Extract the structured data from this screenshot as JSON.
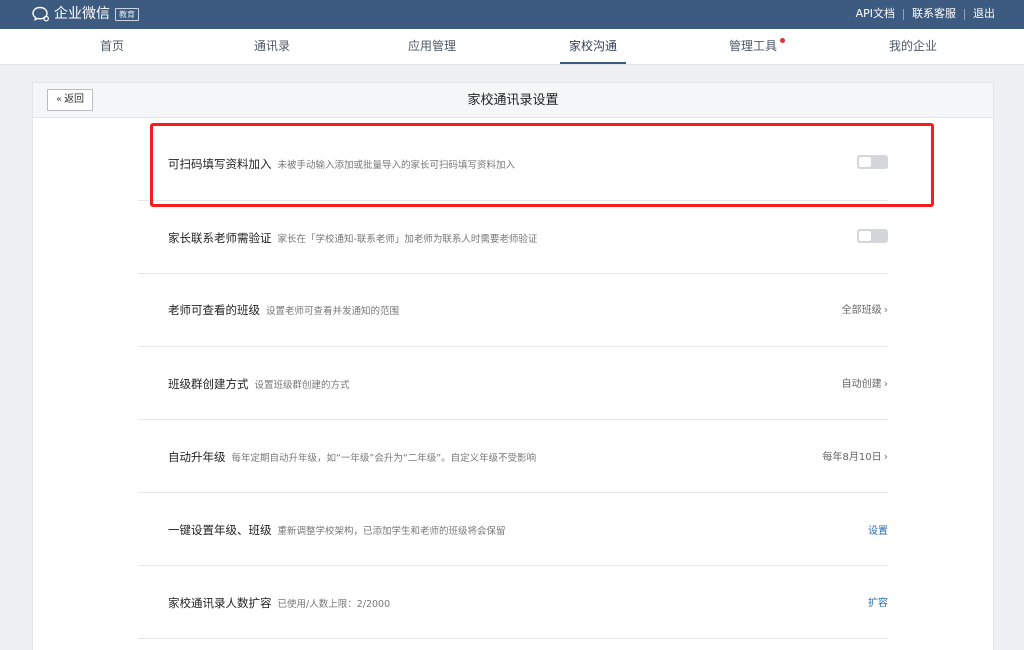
{
  "app": {
    "name": "企业微信",
    "edition_badge": "教育"
  },
  "top_links": [
    "API文档",
    "联系客服",
    "退出"
  ],
  "nav": {
    "items": [
      "首页",
      "通讯录",
      "应用管理",
      "家校沟通",
      "管理工具",
      "我的企业"
    ],
    "active": "家校沟通"
  },
  "page": {
    "back_label": "返回",
    "title": "家校通讯录设置"
  },
  "settings": [
    {
      "title": "可扫码填写资料加入",
      "desc": "未被手动输入添加或批量导入的家长可扫码填写资料加入",
      "control": "toggle",
      "state": "off"
    },
    {
      "title": "家长联系老师需验证",
      "desc": "家长在「学校通知-联系老师」加老师为联系人时需要老师验证",
      "control": "toggle",
      "state": "off"
    },
    {
      "title": "老师可查看的班级",
      "desc": "设置老师可查看并发通知的范围",
      "control": "select",
      "value": "全部班级"
    },
    {
      "title": "班级群创建方式",
      "desc": "设置班级群创建的方式",
      "control": "select",
      "value": "自动创建"
    },
    {
      "title": "自动升年级",
      "desc": "每年定期自动升年级，如“一年级”会升为“二年级”。自定义年级不受影响",
      "control": "select",
      "value": "每年8月10日"
    },
    {
      "title": "一键设置年级、班级",
      "desc": "重新调整学校架构，已添加学生和老师的班级将会保留",
      "control": "link",
      "value": "设置"
    },
    {
      "title": "家校通讯录人数扩容",
      "desc": "已使用/人数上限：2/2000",
      "control": "link",
      "value": "扩容"
    }
  ],
  "colors": {
    "topbar": "#3d5a80",
    "highlight": "#f51d1d",
    "link": "#2b6cb0"
  }
}
